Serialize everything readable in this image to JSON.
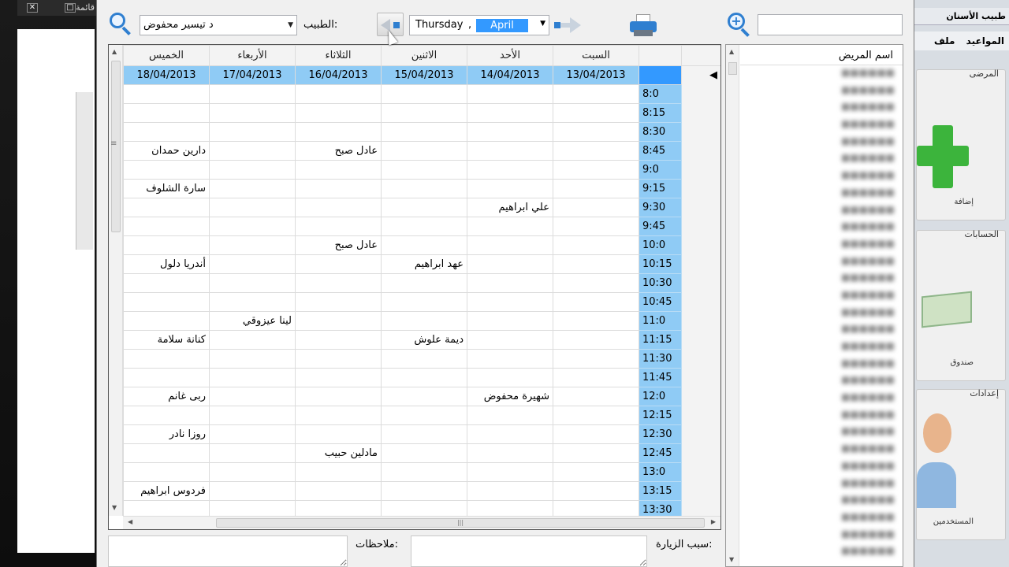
{
  "background": {
    "left_window_controls": [
      "✕",
      "□"
    ],
    "left_window_title": "قائمة",
    "right_window_title": "طبيب الأسنان",
    "right_menu": [
      "ملف",
      "المواعيد"
    ],
    "right_groups": [
      {
        "label": "المرضى",
        "caption": "إضافة"
      },
      {
        "label": "الحسابات",
        "caption": "صندوق"
      },
      {
        "label": "إعدادات",
        "caption": "المستخدمين"
      }
    ]
  },
  "toolbar": {
    "doctor_label": "الطبيب:",
    "doctor_value": "د تيسير محفوض",
    "date_day": "Thursday",
    "date_sep": ",",
    "date_month": "April"
  },
  "grid": {
    "days": [
      "السبت",
      "الأحد",
      "الاثنين",
      "الثلاثاء",
      "الأربعاء",
      "الخميس"
    ],
    "dates": [
      "13/04/2013",
      "14/04/2013",
      "15/04/2013",
      "16/04/2013",
      "17/04/2013",
      "18/04/2013"
    ],
    "rows": [
      {
        "time": "8:0",
        "cells": [
          "",
          "",
          "",
          "",
          "",
          ""
        ]
      },
      {
        "time": "8:15",
        "cells": [
          "",
          "",
          "",
          "",
          "",
          ""
        ]
      },
      {
        "time": "8:30",
        "cells": [
          "",
          "",
          "",
          "",
          "",
          ""
        ]
      },
      {
        "time": "8:45",
        "cells": [
          "",
          "",
          "",
          "عادل صبح",
          "",
          "دارين حمدان"
        ]
      },
      {
        "time": "9:0",
        "cells": [
          "",
          "",
          "",
          "",
          "",
          ""
        ]
      },
      {
        "time": "9:15",
        "cells": [
          "",
          "",
          "",
          "",
          "",
          "سارة الشلوف"
        ]
      },
      {
        "time": "9:30",
        "cells": [
          "",
          "علي ابراهيم",
          "",
          "",
          "",
          ""
        ]
      },
      {
        "time": "9:45",
        "cells": [
          "",
          "",
          "",
          "",
          "",
          ""
        ]
      },
      {
        "time": "10:0",
        "cells": [
          "",
          "",
          "",
          "عادل صبح",
          "",
          ""
        ]
      },
      {
        "time": "10:15",
        "cells": [
          "",
          "",
          "عهد ابراهيم",
          "",
          "",
          "أندريا دلول"
        ]
      },
      {
        "time": "10:30",
        "cells": [
          "",
          "",
          "",
          "",
          "",
          ""
        ]
      },
      {
        "time": "10:45",
        "cells": [
          "",
          "",
          "",
          "",
          "",
          ""
        ]
      },
      {
        "time": "11:0",
        "cells": [
          "",
          "",
          "",
          "",
          "لينا عيزوقي",
          ""
        ]
      },
      {
        "time": "11:15",
        "cells": [
          "",
          "",
          "ديمة علوش",
          "",
          "",
          "كنانة سلامة"
        ]
      },
      {
        "time": "11:30",
        "cells": [
          "",
          "",
          "",
          "",
          "",
          ""
        ]
      },
      {
        "time": "11:45",
        "cells": [
          "",
          "",
          "",
          "",
          "",
          ""
        ]
      },
      {
        "time": "12:0",
        "cells": [
          "",
          "شهيرة محفوض",
          "",
          "",
          "",
          "ربى غانم"
        ]
      },
      {
        "time": "12:15",
        "cells": [
          "",
          "",
          "",
          "",
          "",
          ""
        ]
      },
      {
        "time": "12:30",
        "cells": [
          "",
          "",
          "",
          "",
          "",
          "روزا نادر"
        ]
      },
      {
        "time": "12:45",
        "cells": [
          "",
          "",
          "",
          "مادلين حبيب",
          "",
          ""
        ]
      },
      {
        "time": "13:0",
        "cells": [
          "",
          "",
          "",
          "",
          "",
          ""
        ]
      },
      {
        "time": "13:15",
        "cells": [
          "",
          "",
          "",
          "",
          "",
          "فردوس ابراهيم"
        ]
      },
      {
        "time": "13:30",
        "cells": [
          "",
          "",
          "",
          "",
          "",
          ""
        ]
      }
    ]
  },
  "patients": {
    "header": "اسم المريض"
  },
  "bottom": {
    "notes_label": "ملاحظات:",
    "reason_label": "سبب الزيارة:"
  }
}
